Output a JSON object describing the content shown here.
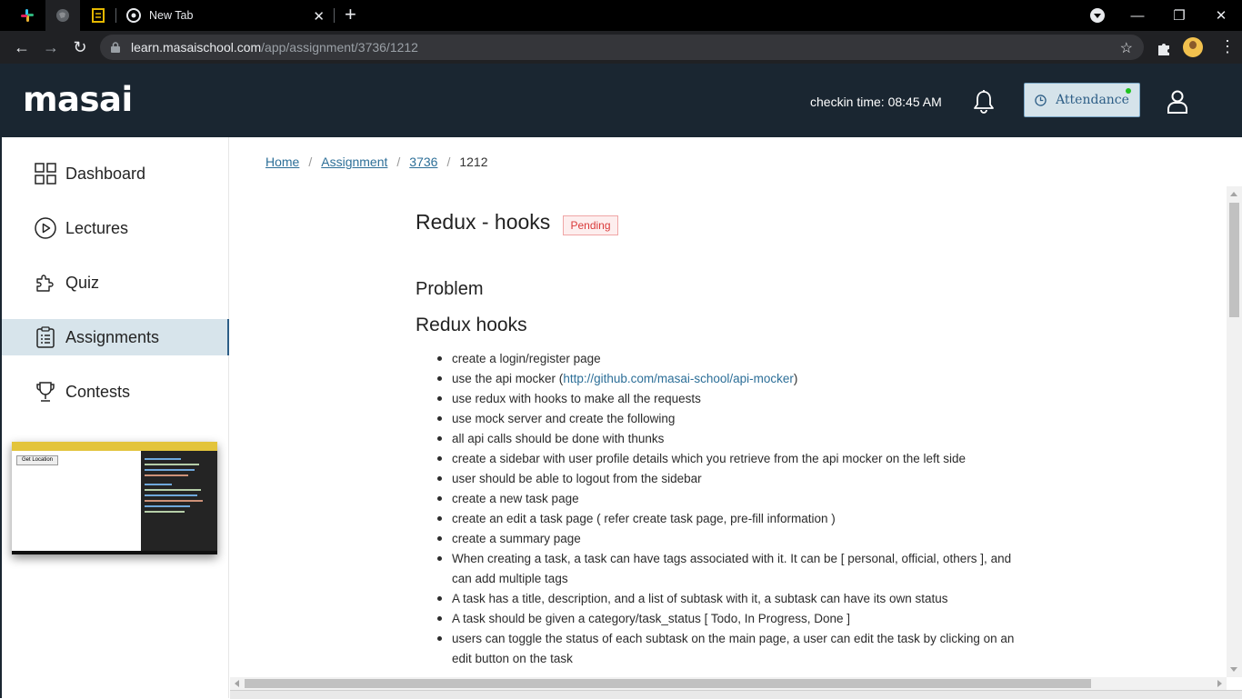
{
  "browser": {
    "tabs": [
      {
        "name": "slack-tab",
        "icon": "slack-icon"
      },
      {
        "name": "globe-tab",
        "icon": "globe-icon"
      },
      {
        "name": "notes-tab",
        "icon": "document-icon"
      },
      {
        "name": "new-tab",
        "label": "New Tab",
        "icon": "chrome-icon",
        "active": true
      }
    ],
    "url_host": "learn.masaischool.com",
    "url_path": "/app/assignment/3736/1212"
  },
  "header": {
    "logo_text": "masai",
    "checkin_label": "checkin time: 08:45 AM",
    "attendance_label": "Attendance",
    "colors": {
      "header_bg": "#1a2631",
      "accent_red": "#ed3b3b",
      "attendance_bg": "#d5e3ea",
      "online_dot": "#1ec31e"
    }
  },
  "sidebar": {
    "items": [
      {
        "label": "Dashboard",
        "icon": "grid-icon"
      },
      {
        "label": "Lectures",
        "icon": "play-circle-icon"
      },
      {
        "label": "Quiz",
        "icon": "puzzle-icon"
      },
      {
        "label": "Assignments",
        "icon": "clipboard-icon",
        "active": true
      },
      {
        "label": "Contests",
        "icon": "trophy-icon"
      }
    ],
    "preview_button": "Get Location"
  },
  "breadcrumb": [
    "Home",
    "Assignment",
    "3736",
    "1212"
  ],
  "assignment": {
    "title": "Redux - hooks",
    "status": "Pending",
    "section_problem": "Problem",
    "section_heading": "Redux hooks",
    "items": [
      "create a login/register page",
      "use the api mocker (",
      "use redux with hooks to make all the requests",
      "use mock server and create the following",
      "all api calls should be done with thunks",
      "create a sidebar with user profile details which you retrieve from the api mocker on the left side",
      "user should be able to logout from the sidebar",
      "create a new task page",
      "create an edit a task page ( refer create task page, pre-fill information )",
      "create a summary page",
      "When creating a task, a task can have tags associated with it. It can be [ personal, official, others ], and can add multiple tags",
      "A task has a title, description, and a list of subtask with it, a subtask can have its own status",
      "A task should be given a category/task_status [ Todo, In Progress, Done ]",
      "users can toggle the status of each subtask on the main page, a user can edit the task by clicking on an edit button on the task"
    ],
    "api_mocker_link": "http://github.com/masai-school/api-mocker",
    "api_mocker_close": ")"
  }
}
